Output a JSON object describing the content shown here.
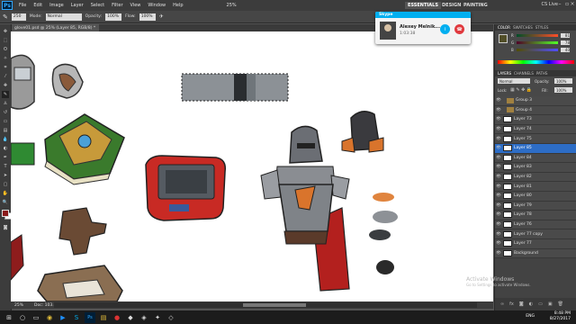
{
  "menubar": {
    "logo": "Ps",
    "items": [
      "File",
      "Edit",
      "Image",
      "Layer",
      "Select",
      "Filter",
      "View",
      "Window",
      "Help"
    ],
    "zoom": "25%",
    "workspaces": [
      "ESSENTIALS",
      "DESIGN",
      "PAINTING"
    ],
    "cs_live": "CS Live"
  },
  "options": {
    "mode_label": "Mode:",
    "mode_value": "Normal",
    "opacity_label": "Opacity:",
    "opacity_value": "100%",
    "flow_label": "Flow:",
    "flow_value": "100%",
    "brush_size": "250"
  },
  "document": {
    "tab_title": "glove01.psd @ 25% (Layer 85, RGB/8) *"
  },
  "status": {
    "zoom": "25%",
    "doc": "Doc: 103.0M/167.4M"
  },
  "skype": {
    "header": "Skype",
    "name": "Alexey Melnik...",
    "time": "1:03:38"
  },
  "panel": {
    "color_tabs": [
      "COLOR",
      "SWATCHES",
      "STYLES"
    ],
    "r_label": "R",
    "g_label": "G",
    "b_label": "B",
    "r": "81",
    "g": "78",
    "b": "40",
    "layers_tabs": [
      "LAYERS",
      "CHANNELS",
      "PATHS"
    ],
    "blend": "Normal",
    "opacity_label": "Opacity:",
    "opacity": "100%",
    "lock_label": "Lock:",
    "fill_label": "Fill:",
    "fill": "100%"
  },
  "layers": [
    {
      "name": "Group 3",
      "type": "group"
    },
    {
      "name": "Group 4",
      "type": "group"
    },
    {
      "name": "Layer 73",
      "type": "layer"
    },
    {
      "name": "Layer 74",
      "type": "layer"
    },
    {
      "name": "Layer 75",
      "type": "layer"
    },
    {
      "name": "Layer 85",
      "type": "layer",
      "selected": true
    },
    {
      "name": "Layer 84",
      "type": "layer"
    },
    {
      "name": "Layer 83",
      "type": "layer"
    },
    {
      "name": "Layer 82",
      "type": "layer"
    },
    {
      "name": "Layer 81",
      "type": "layer"
    },
    {
      "name": "Layer 80",
      "type": "layer"
    },
    {
      "name": "Layer 79",
      "type": "layer"
    },
    {
      "name": "Layer 78",
      "type": "layer"
    },
    {
      "name": "Layer 76",
      "type": "layer"
    },
    {
      "name": "Layer 77 copy",
      "type": "layer"
    },
    {
      "name": "Layer 77",
      "type": "layer"
    },
    {
      "name": "Background",
      "type": "layer"
    }
  ],
  "watermark": {
    "line1": "Activate Windows",
    "line2": "Go to Settings to activate Windows."
  },
  "taskbar": {
    "time": "8:48 PM",
    "date": "8/27/2017",
    "lang": "ENG"
  },
  "colors": {
    "selected_layer": "#2d6dc6",
    "foreground": "#8b1a1a",
    "skype_blue": "#00aff0",
    "end_call": "#e0393e"
  }
}
